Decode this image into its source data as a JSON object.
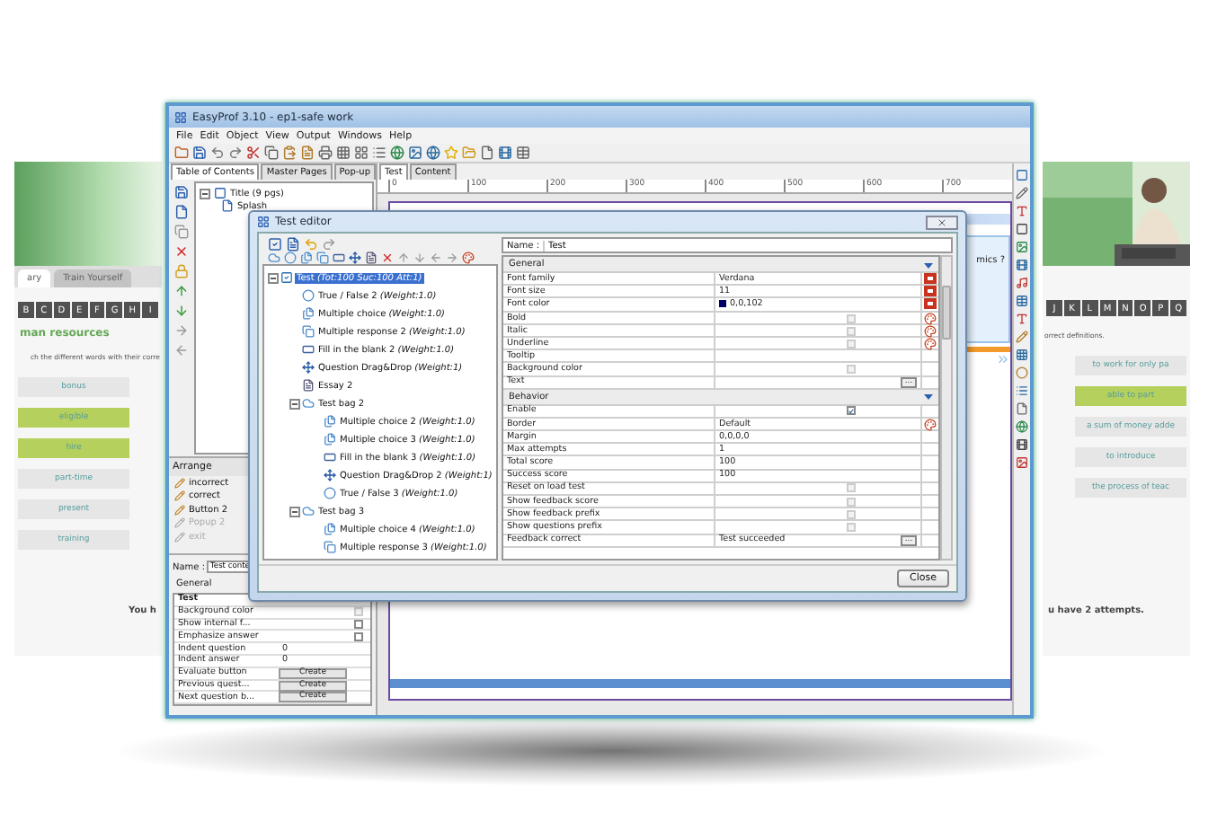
{
  "window": {
    "title": "EasyProf 3.10 - ep1-safe work",
    "menu": [
      "File",
      "Edit",
      "Object",
      "View",
      "Output",
      "Windows",
      "Help"
    ]
  },
  "side_tabs": [
    {
      "label": "Table of Contents",
      "selected": true
    },
    {
      "label": "Master Pages",
      "selected": false
    },
    {
      "label": "Pop-up",
      "selected": false
    }
  ],
  "toc": [
    {
      "label": "Title (9 pgs)",
      "expanded": true,
      "children": [
        {
          "label": "Splash"
        }
      ]
    }
  ],
  "doc_tabs": [
    {
      "label": "Test",
      "selected": true
    },
    {
      "label": "Content",
      "selected": false
    }
  ],
  "ruler": [
    "0",
    "100",
    "200",
    "300",
    "400",
    "500",
    "600",
    "700"
  ],
  "canvas": {
    "text": "mics ?"
  },
  "arrange": {
    "title": "Arrange",
    "items": [
      {
        "label": "incorrect",
        "disabled": false
      },
      {
        "label": "correct",
        "disabled": false
      },
      {
        "label": "Button 2",
        "disabled": false
      },
      {
        "label": "Popup 2",
        "disabled": true
      },
      {
        "label": "exit",
        "disabled": true
      }
    ]
  },
  "properties": {
    "name_label": "Name :",
    "name_value": "Test conte",
    "tab": "General",
    "rows": [
      {
        "kind": "header",
        "label": "Test"
      },
      {
        "kind": "check",
        "label": "Background color",
        "checked": false,
        "disabled": true
      },
      {
        "kind": "check",
        "label": "Show internal f...",
        "checked": false,
        "disabled": false
      },
      {
        "kind": "check",
        "label": "Emphasize answer",
        "checked": false,
        "disabled": false
      },
      {
        "kind": "text",
        "label": "Indent question",
        "value": "0"
      },
      {
        "kind": "text",
        "label": "Indent answer",
        "value": "0"
      },
      {
        "kind": "button",
        "label": "Evaluate button",
        "value": "Create"
      },
      {
        "kind": "button",
        "label": "Previous quest...",
        "value": "Create"
      },
      {
        "kind": "button",
        "label": "Next question b...",
        "value": "Create"
      }
    ]
  },
  "editor": {
    "title": "Test editor",
    "tree": [
      {
        "kind": "test",
        "label": "Test *(Tot:100 Suc:100 Att:1)*",
        "selected": true,
        "expanded": true,
        "children": [
          {
            "kind": "tf",
            "label": "True / False 2 *(Weight:1.0)*",
            "selected": false
          },
          {
            "kind": "mc",
            "label": "Multiple choice *(Weight:1.0)*",
            "selected": false
          },
          {
            "kind": "mr",
            "label": "Multiple response 2 *(Weight:1.0)*",
            "selected": false
          },
          {
            "kind": "fib",
            "label": "Fill in the blank 2 *(Weight:1.0)*",
            "selected": false
          },
          {
            "kind": "dd",
            "label": "Question Drag&Drop *(Weight:1)*",
            "selected": false
          },
          {
            "kind": "essay",
            "label": "Essay 2",
            "selected": false
          },
          {
            "kind": "bag",
            "label": "Test bag 2",
            "selected": false,
            "expanded": true,
            "children": [
              {
                "kind": "mc",
                "label": "Multiple choice 2 *(Weight:1.0)*",
                "selected": false
              },
              {
                "kind": "mc",
                "label": "Multiple choice 3 *(Weight:1.0)*",
                "selected": false
              },
              {
                "kind": "fib",
                "label": "Fill in the blank 3 *(Weight:1.0)*",
                "selected": false
              },
              {
                "kind": "dd",
                "label": "Question Drag&Drop 2 *(Weight:1)*",
                "selected": false
              },
              {
                "kind": "tf",
                "label": "True / False 3 *(Weight:1.0)*",
                "selected": false
              }
            ]
          },
          {
            "kind": "bag",
            "label": "Test bag 3",
            "selected": false,
            "expanded": true,
            "children": [
              {
                "kind": "mc",
                "label": "Multiple choice 4 *(Weight:1.0)*",
                "selected": false
              },
              {
                "kind": "mr",
                "label": "Multiple response 3 *(Weight:1.0)*",
                "selected": false
              }
            ]
          }
        ]
      }
    ],
    "name_label": "Name :",
    "name_value": "Test",
    "sections": [
      {
        "title": "General",
        "rows": [
          {
            "kind": "text",
            "label": "Font family",
            "value": "Verdana",
            "resettable": true
          },
          {
            "kind": "text",
            "label": "Font size",
            "value": "11",
            "resettable": true
          },
          {
            "kind": "color",
            "label": "Font color",
            "value": "0,0,102",
            "color": "#000066",
            "resettable": true
          },
          {
            "kind": "check",
            "label": "Bold",
            "checked": false,
            "disabled": true,
            "styleable": true
          },
          {
            "kind": "check",
            "label": "Italic",
            "checked": false,
            "disabled": true,
            "styleable": true
          },
          {
            "kind": "check",
            "label": "Underline",
            "checked": false,
            "disabled": true,
            "styleable": true
          },
          {
            "kind": "text",
            "label": "Tooltip"
          },
          {
            "kind": "check",
            "label": "Background color",
            "checked": false,
            "disabled": true
          },
          {
            "kind": "text",
            "label": "Text",
            "button": "..."
          }
        ]
      },
      {
        "title": "Behavior",
        "rows": [
          {
            "kind": "check",
            "label": "Enable",
            "checked": true,
            "disabled": false
          },
          {
            "kind": "text",
            "label": "Border",
            "value": "Default",
            "styleable": true
          },
          {
            "kind": "text",
            "label": "Margin",
            "value": "0,0,0,0"
          },
          {
            "kind": "text",
            "label": "Max attempts",
            "value": "1"
          },
          {
            "kind": "text",
            "label": "Total score",
            "value": "100"
          },
          {
            "kind": "text",
            "label": "Success score",
            "value": "100"
          },
          {
            "kind": "check",
            "label": "Reset on load test",
            "checked": false,
            "disabled": true
          },
          {
            "kind": "check",
            "label": "Show feedback score",
            "checked": false,
            "disabled": true
          },
          {
            "kind": "check",
            "label": "Show feedback prefix",
            "checked": false,
            "disabled": true
          },
          {
            "kind": "check",
            "label": "Show questions prefix",
            "checked": false,
            "disabled": true
          },
          {
            "kind": "text",
            "label": "Feedback correct",
            "value": "Test succeeded",
            "button": "..."
          }
        ]
      }
    ],
    "close": "Close"
  },
  "left_preview": {
    "tabs": [
      {
        "label": "ary",
        "selected": true
      },
      {
        "label": "Train Yourself",
        "selected": false
      }
    ],
    "letters": [
      "B",
      "C",
      "D",
      "E",
      "F",
      "G",
      "H",
      "I"
    ],
    "heading": "man resources",
    "instruction": "ch the different words with their corre",
    "words": [
      {
        "label": "bonus",
        "matched": false
      },
      {
        "label": "eligible",
        "matched": true
      },
      {
        "label": "hire",
        "matched": true
      },
      {
        "label": "part-time",
        "matched": false
      },
      {
        "label": "present",
        "matched": false
      },
      {
        "label": "training",
        "matched": false
      }
    ],
    "footer": "You h"
  },
  "right_preview": {
    "letters": [
      "J",
      "K",
      "L",
      "M",
      "N",
      "O",
      "P",
      "Q"
    ],
    "instruction": "orrect definitions.",
    "words": [
      {
        "label": "to work for only pa",
        "matched": false
      },
      {
        "label": "able to part",
        "matched": true
      },
      {
        "label": "a sum of money adde",
        "matched": false
      },
      {
        "label": "to introduce",
        "matched": false
      },
      {
        "label": "the process of teac",
        "matched": false
      }
    ],
    "footer": "u have 2 attempts."
  }
}
